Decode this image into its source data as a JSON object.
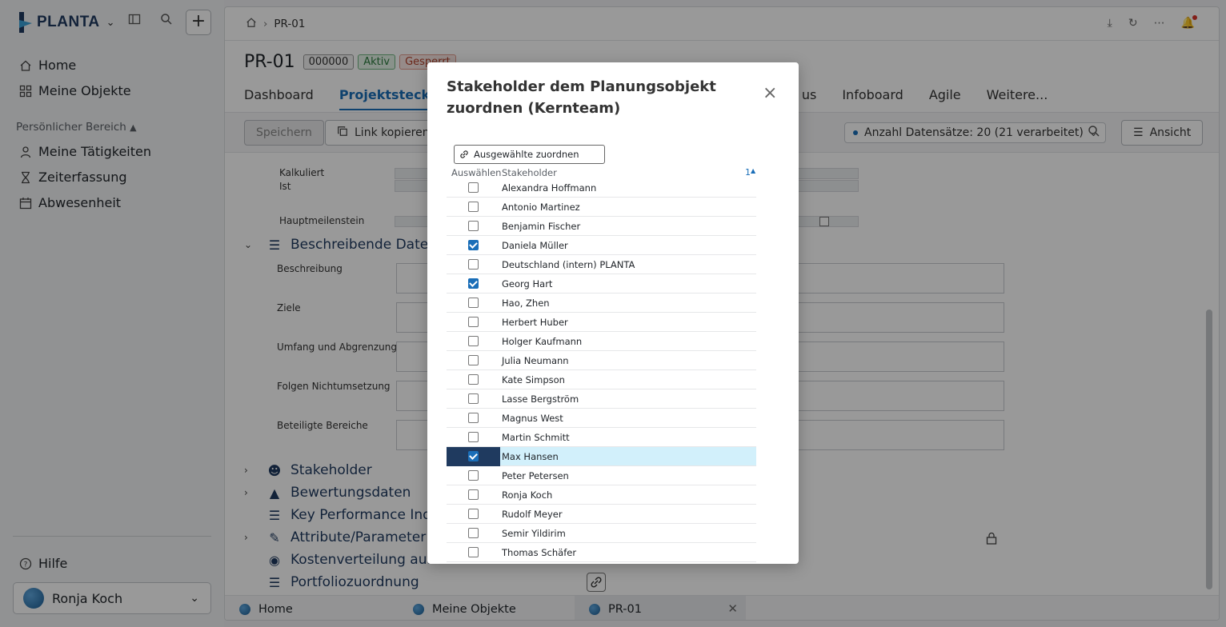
{
  "app": {
    "brand": "PLANTA"
  },
  "sidebar": {
    "nav": [
      {
        "label": "Home",
        "icon": "home-icon"
      },
      {
        "label": "Meine Objekte",
        "icon": "grid-icon"
      }
    ],
    "section_label": "Persönlicher Bereich",
    "personal": [
      {
        "label": "Meine Tätigkeiten",
        "icon": "person-icon"
      },
      {
        "label": "Zeiterfassung",
        "icon": "hourglass-icon"
      },
      {
        "label": "Abwesenheit",
        "icon": "calendar-icon"
      }
    ],
    "help_label": "Hilfe",
    "user_name": "Ronja Koch"
  },
  "header": {
    "breadcrumb": "PR-01",
    "project_id": "PR-01",
    "badges": {
      "number": "000000",
      "status": "Aktiv",
      "locked": "Gesperrt"
    }
  },
  "tabs": [
    "Dashboard",
    "Projektsteckbrief",
    "us",
    "Infoboard",
    "Agile",
    "Weitere..."
  ],
  "toolbar": {
    "save_label": "Speichern",
    "copy_link_label": "Link kopieren",
    "record_count": "Anzahl Datensätze: 20 (21 verarbeitet)",
    "view_label": "Ansicht"
  },
  "content": {
    "plan_labels": [
      "Kalkuliert",
      "Ist",
      "Hauptmeilenstein"
    ],
    "section_descriptive": "Beschreibende Daten",
    "fields": [
      "Beschreibung",
      "Ziele",
      "Umfang und Abgrenzung",
      "Folgen Nichtumsetzung",
      "Beteiligte Bereiche"
    ],
    "sections": [
      {
        "label": "Stakeholder",
        "icon": "people-icon",
        "expandable": true
      },
      {
        "label": "Bewertungsdaten",
        "icon": "chart-area-icon",
        "expandable": true
      },
      {
        "label": "Key Performance Indic",
        "icon": "list-icon",
        "expandable": false
      },
      {
        "label": "Attribute/Parameter",
        "icon": "edit-icon",
        "expandable": true
      },
      {
        "label": "Kostenverteilung auf K",
        "icon": "coins-icon",
        "expandable": false
      },
      {
        "label": "Portfoliozuordnung",
        "icon": "list-icon",
        "expandable": false
      }
    ]
  },
  "bottom_tabs": [
    {
      "label": "Home"
    },
    {
      "label": "Meine Objekte"
    },
    {
      "label": "PR-01",
      "active": true
    }
  ],
  "modal": {
    "title": "Stakeholder dem Planungsobjekt zuordnen (Kernteam)",
    "assign_button": "Ausgewählte zuordnen",
    "col_select": "Auswählen",
    "col_stakeholder": "Stakeholder",
    "sort_indicator": "1",
    "rows": [
      {
        "name": "Alexandra Hoffmann",
        "checked": false
      },
      {
        "name": "Antonio Martinez",
        "checked": false
      },
      {
        "name": "Benjamin Fischer",
        "checked": false
      },
      {
        "name": "Daniela Müller",
        "checked": true
      },
      {
        "name": "Deutschland (intern) PLANTA",
        "checked": false
      },
      {
        "name": "Georg Hart",
        "checked": true
      },
      {
        "name": "Hao, Zhen",
        "checked": false
      },
      {
        "name": "Herbert Huber",
        "checked": false
      },
      {
        "name": "Holger Kaufmann",
        "checked": false
      },
      {
        "name": "Julia Neumann",
        "checked": false
      },
      {
        "name": "Kate Simpson",
        "checked": false
      },
      {
        "name": "Lasse Bergström",
        "checked": false
      },
      {
        "name": "Magnus West",
        "checked": false
      },
      {
        "name": "Martin Schmitt",
        "checked": false
      },
      {
        "name": "Max Hansen",
        "checked": true,
        "highlighted": true
      },
      {
        "name": "Peter Petersen",
        "checked": false
      },
      {
        "name": "Ronja Koch",
        "checked": false
      },
      {
        "name": "Rudolf Meyer",
        "checked": false
      },
      {
        "name": "Semir Yildirim",
        "checked": false
      },
      {
        "name": "Thomas Schäfer",
        "checked": false
      }
    ]
  },
  "colors": {
    "accent": "#1a6eb8",
    "brand_dark": "#1f3a5f",
    "selected_row": "#d2f0fb"
  }
}
